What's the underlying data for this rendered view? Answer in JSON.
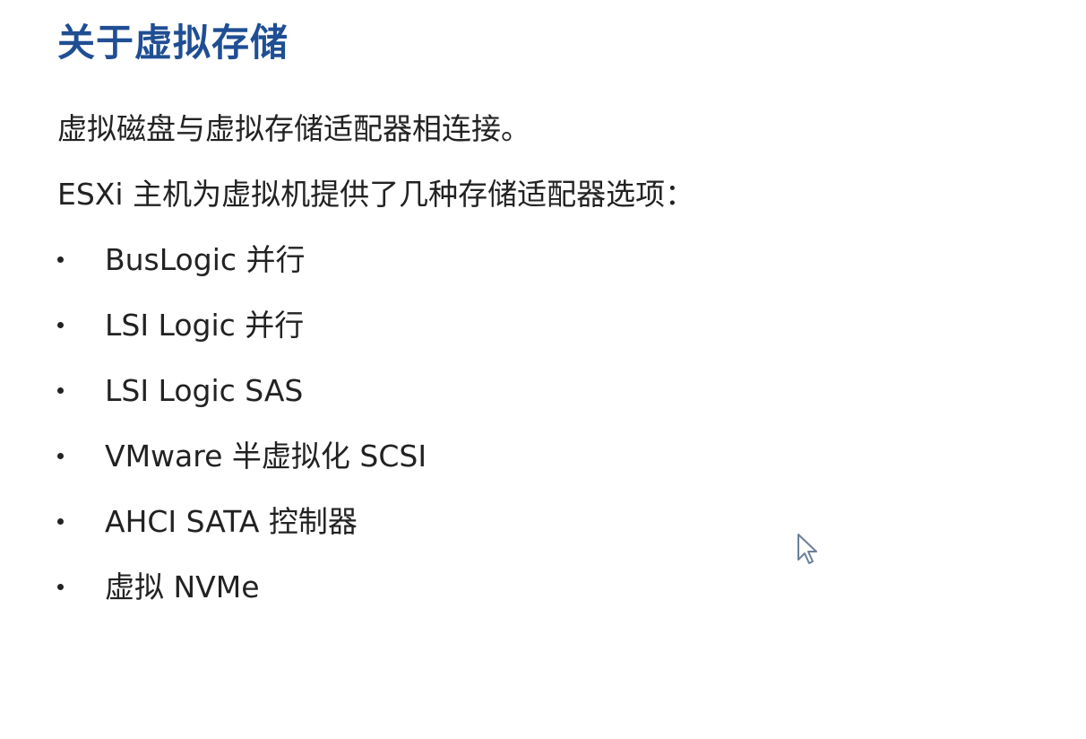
{
  "slide": {
    "title": "关于虚拟存储",
    "paragraphs": [
      "虚拟磁盘与虚拟存储适配器相连接。",
      "ESXi 主机为虚拟机提供了几种存储适配器选项："
    ],
    "bullets": [
      "BusLogic 并行",
      "LSI Logic 并行",
      "LSI Logic SAS",
      "VMware 半虚拟化 SCSI",
      "AHCI SATA 控制器",
      "虚拟 NVMe"
    ]
  },
  "colors": {
    "title": "#1f4e93",
    "body_text": "#222222",
    "background": "#ffffff"
  },
  "icons": {
    "cursor": "mouse-pointer-icon"
  }
}
